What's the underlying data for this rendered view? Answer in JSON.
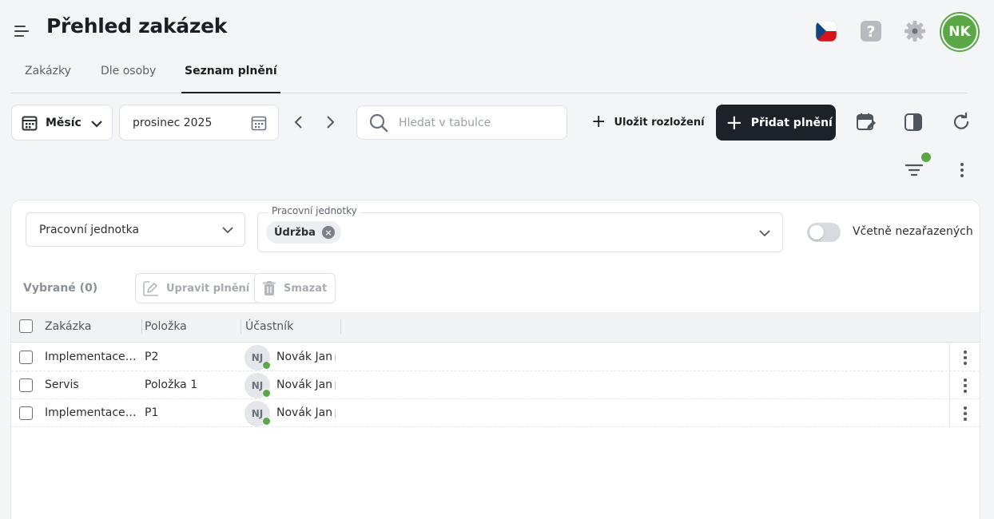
{
  "header": {
    "title": "Přehled zakázek",
    "user_initials": "NK"
  },
  "tabs": [
    {
      "label": "Zakázky",
      "active": false
    },
    {
      "label": "Dle osoby",
      "active": false
    },
    {
      "label": "Seznam plnění",
      "active": true
    }
  ],
  "toolbar": {
    "period_label": "Měsíc",
    "date_value": "prosinec 2025",
    "search_placeholder": "Hledat v tabulce",
    "save_layout_label": "Uložit rozložení",
    "add_label": "Přidat plnění"
  },
  "filters": {
    "unit_select_label": "Pracovní jednotka",
    "units_field_label": "Pracovní jednotky",
    "units_chip": "Údržba",
    "include_unassigned_label": "Včetně nezařazených",
    "include_unassigned_on": false
  },
  "actions": {
    "selected_label": "Vybrané (0)",
    "edit_label": "Upravit plnění",
    "delete_label": "Smazat"
  },
  "table": {
    "columns": [
      "Zakázka",
      "Položka",
      "Účastník"
    ],
    "rows": [
      {
        "order": "Implementace ...",
        "item": "P2",
        "participant": "Novák Jan",
        "initials": "NJ"
      },
      {
        "order": "Servis",
        "item": "Položka 1",
        "participant": "Novák Jan",
        "initials": "NJ"
      },
      {
        "order": "Implementace ...",
        "item": "P1",
        "participant": "Novák Jan",
        "initials": "NJ"
      }
    ]
  },
  "colors": {
    "accent_green": "#5aa845",
    "primary_dark": "#1d2228"
  }
}
